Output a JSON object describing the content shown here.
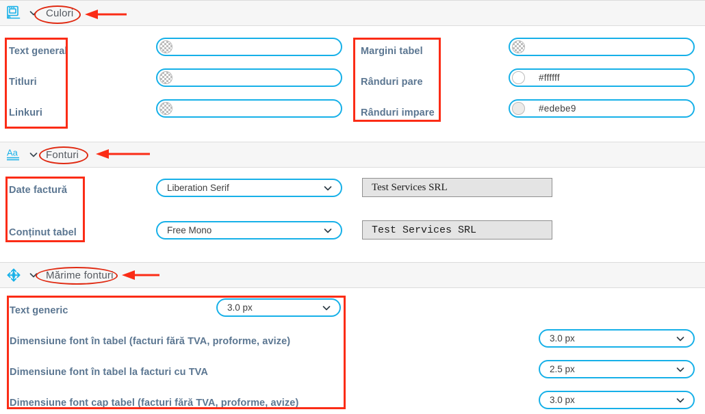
{
  "sections": [
    {
      "id": "culori",
      "title": "Culori",
      "icon": "color-theme-icon",
      "chevron": "chevron-down-icon",
      "fields_left": [
        {
          "label": "Text general",
          "control": "color",
          "value": "",
          "swatch": "transparent"
        },
        {
          "label": "Titluri",
          "control": "color",
          "value": "",
          "swatch": "transparent"
        },
        {
          "label": "Linkuri",
          "control": "color",
          "value": "",
          "swatch": "transparent"
        }
      ],
      "fields_right": [
        {
          "label": "Margini tabel",
          "control": "color",
          "value": "",
          "swatch": "transparent"
        },
        {
          "label": "Rânduri pare",
          "control": "color",
          "value": "#ffffff",
          "swatch": "#ffffff"
        },
        {
          "label": "Rânduri impare",
          "control": "color",
          "value": "#edebe9",
          "swatch": "#edebe9"
        }
      ]
    },
    {
      "id": "fonturi",
      "title": "Fonturi",
      "icon": "typography-aa-icon",
      "chevron": "chevron-down-icon",
      "fields": [
        {
          "label": "Date factură",
          "select": "Liberation Serif",
          "preview": "Test Services SRL"
        },
        {
          "label": "Conținut tabel",
          "select": "Free Mono",
          "preview": "Test Services SRL"
        }
      ]
    },
    {
      "id": "marime-fonturi",
      "title": "Mărime fonturi",
      "icon": "move-arrows-icon",
      "chevron": "chevron-down-icon",
      "fields": [
        {
          "label": "Text generic",
          "select": "3.0 px",
          "select_position": "inline"
        },
        {
          "label": "Dimensiune font în tabel (facturi fără TVA, proforme, avize)",
          "select": "3.0 px",
          "select_position": "right"
        },
        {
          "label": "Dimensiune font în tabel la facturi cu TVA",
          "select": "2.5 px",
          "select_position": "right"
        },
        {
          "label": "Dimensiune font cap tabel (facturi fără TVA, proforme, avize)",
          "select": "3.0 px",
          "select_position": "right"
        }
      ]
    }
  ],
  "annotations": {
    "color_accent": "#fb2c16",
    "boxes": [
      {
        "name": "culori-left-labels-box"
      },
      {
        "name": "culori-right-labels-box"
      },
      {
        "name": "fonturi-labels-box"
      },
      {
        "name": "marime-fonturi-labels-box"
      }
    ],
    "ellipses": [
      {
        "name": "culori-title-ellipse"
      },
      {
        "name": "fonturi-title-ellipse"
      },
      {
        "name": "marime-fonturi-title-ellipse"
      }
    ],
    "arrows": [
      {
        "name": "culori-title-arrow"
      },
      {
        "name": "fonturi-title-arrow"
      },
      {
        "name": "marime-fonturi-title-arrow"
      }
    ]
  }
}
